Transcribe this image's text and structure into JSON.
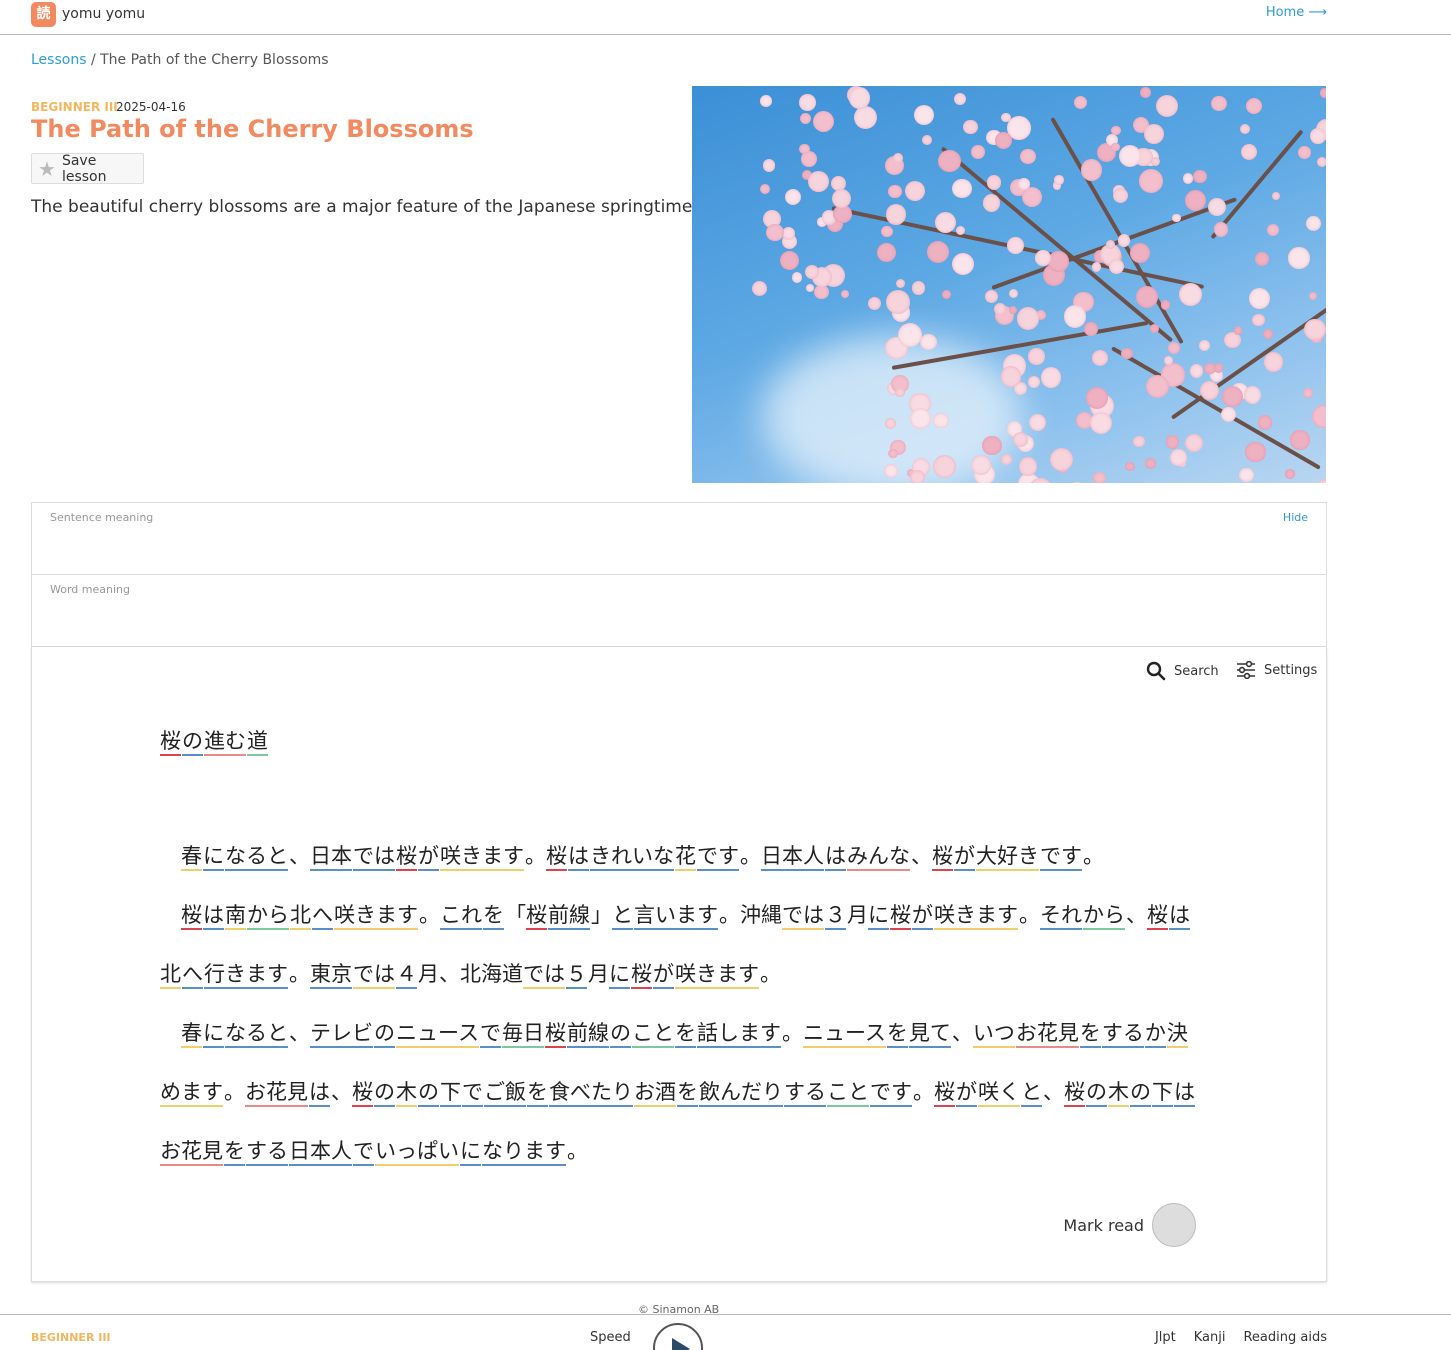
{
  "header": {
    "brand": "yomu yomu",
    "logo_glyph": "読",
    "home_link": "Home ⟶"
  },
  "breadcrumb": {
    "root": "Lessons",
    "separator": " / ",
    "current": "The Path of the Cherry Blossoms"
  },
  "lesson": {
    "level": "BEGINNER III",
    "date": "2025-04-16",
    "title": "The Path of the Cherry Blossoms",
    "save_label": "Save lesson",
    "description": "The beautiful cherry blossoms are a major feature of the Japanese springtime."
  },
  "meaning": {
    "sentence_label": "Sentence meaning",
    "hide_label": "Hide",
    "word_label": "Word meaning"
  },
  "reader": {
    "search_label": "Search",
    "settings_label": "Settings",
    "title_words": [
      {
        "t": "桜",
        "c": "r"
      },
      {
        "t": "の",
        "c": "b"
      },
      {
        "t": "進む",
        "c": "p"
      },
      {
        "t": "道",
        "c": "g"
      }
    ],
    "paragraphs": [
      [
        {
          "t": "春",
          "c": "y"
        },
        {
          "t": "に",
          "c": "b"
        },
        {
          "t": "なると",
          "c": "b"
        },
        {
          "t": "、",
          "c": ""
        },
        {
          "t": "日本",
          "c": "b"
        },
        {
          "t": "では",
          "c": "b"
        },
        {
          "t": "桜",
          "c": "r"
        },
        {
          "t": "が",
          "c": "b"
        },
        {
          "t": "咲きます",
          "c": "y"
        },
        {
          "t": "。",
          "c": ""
        },
        {
          "t": "桜",
          "c": "r"
        },
        {
          "t": "は",
          "c": "b"
        },
        {
          "t": "きれいな",
          "c": "b"
        },
        {
          "t": "花",
          "c": "y"
        },
        {
          "t": "です",
          "c": "b"
        },
        {
          "t": "。",
          "c": ""
        },
        {
          "t": "日本人",
          "c": "b"
        },
        {
          "t": "は",
          "c": "b"
        },
        {
          "t": "みんな",
          "c": "p"
        },
        {
          "t": "、",
          "c": ""
        },
        {
          "t": "桜",
          "c": "r"
        },
        {
          "t": "が",
          "c": "b"
        },
        {
          "t": "大好き",
          "c": "y"
        },
        {
          "t": "です",
          "c": "b"
        },
        {
          "t": "。",
          "c": ""
        }
      ],
      [
        {
          "t": "桜",
          "c": "r"
        },
        {
          "t": "は",
          "c": "b"
        },
        {
          "t": "南",
          "c": "y"
        },
        {
          "t": "から",
          "c": "g"
        },
        {
          "t": "北",
          "c": "y"
        },
        {
          "t": "へ",
          "c": "b"
        },
        {
          "t": "咲きます",
          "c": "y"
        },
        {
          "t": "。",
          "c": ""
        },
        {
          "t": "これ",
          "c": "b"
        },
        {
          "t": "を",
          "c": "b"
        },
        {
          "t": "「",
          "c": ""
        },
        {
          "t": "桜",
          "c": "r"
        },
        {
          "t": "前線",
          "c": "b"
        },
        {
          "t": "」",
          "c": ""
        },
        {
          "t": "と",
          "c": "b"
        },
        {
          "t": "言います",
          "c": "b"
        },
        {
          "t": "。",
          "c": ""
        },
        {
          "t": "沖縄",
          "c": ""
        },
        {
          "t": "では",
          "c": "y"
        },
        {
          "t": "３",
          "c": "b"
        },
        {
          "t": "月",
          "c": ""
        },
        {
          "t": "に",
          "c": "b"
        },
        {
          "t": "桜",
          "c": "r"
        },
        {
          "t": "が",
          "c": "b"
        },
        {
          "t": "咲きます",
          "c": "y"
        },
        {
          "t": "。",
          "c": ""
        },
        {
          "t": "それ",
          "c": "b"
        },
        {
          "t": "から",
          "c": "g"
        },
        {
          "t": "、",
          "c": ""
        },
        {
          "t": "桜",
          "c": "r"
        },
        {
          "t": "は",
          "c": "b"
        },
        {
          "t": "北",
          "c": "y"
        },
        {
          "t": "へ",
          "c": "b"
        },
        {
          "t": "行きます",
          "c": "b"
        },
        {
          "t": "。",
          "c": ""
        },
        {
          "t": "東京",
          "c": "b"
        },
        {
          "t": "では",
          "c": "y"
        },
        {
          "t": "４",
          "c": "b"
        },
        {
          "t": "月",
          "c": ""
        },
        {
          "t": "、",
          "c": ""
        },
        {
          "t": "北海道",
          "c": ""
        },
        {
          "t": "では",
          "c": "y"
        },
        {
          "t": "５",
          "c": "b"
        },
        {
          "t": "月",
          "c": ""
        },
        {
          "t": "に",
          "c": "b"
        },
        {
          "t": "桜",
          "c": "r"
        },
        {
          "t": "が",
          "c": "b"
        },
        {
          "t": "咲きます",
          "c": "y"
        },
        {
          "t": "。",
          "c": ""
        }
      ],
      [
        {
          "t": "春",
          "c": "y"
        },
        {
          "t": "に",
          "c": "b"
        },
        {
          "t": "なると",
          "c": "b"
        },
        {
          "t": "、",
          "c": ""
        },
        {
          "t": "テレビ",
          "c": "b"
        },
        {
          "t": "の",
          "c": "b"
        },
        {
          "t": "ニュース",
          "c": "y"
        },
        {
          "t": "で",
          "c": "b"
        },
        {
          "t": "毎日",
          "c": "g"
        },
        {
          "t": "桜",
          "c": "r"
        },
        {
          "t": "前線",
          "c": "b"
        },
        {
          "t": "の",
          "c": "b"
        },
        {
          "t": "こと",
          "c": "g"
        },
        {
          "t": "を",
          "c": "b"
        },
        {
          "t": "話します",
          "c": "b"
        },
        {
          "t": "。",
          "c": ""
        },
        {
          "t": "ニュース",
          "c": "y"
        },
        {
          "t": "を",
          "c": "b"
        },
        {
          "t": "見て",
          "c": "b"
        },
        {
          "t": "、",
          "c": ""
        },
        {
          "t": "いつ",
          "c": "y"
        },
        {
          "t": "お花見",
          "c": "p"
        },
        {
          "t": "を",
          "c": "b"
        },
        {
          "t": "する",
          "c": "b"
        },
        {
          "t": "か",
          "c": "b"
        },
        {
          "t": "決めます",
          "c": "y"
        },
        {
          "t": "。",
          "c": ""
        },
        {
          "t": "お花見",
          "c": "p"
        },
        {
          "t": "は",
          "c": "b"
        },
        {
          "t": "、",
          "c": ""
        },
        {
          "t": "桜",
          "c": "r"
        },
        {
          "t": "の",
          "c": "b"
        },
        {
          "t": "木",
          "c": "y"
        },
        {
          "t": "の",
          "c": "b"
        },
        {
          "t": "下",
          "c": "b"
        },
        {
          "t": "で",
          "c": "b"
        },
        {
          "t": "ご飯",
          "c": "b"
        },
        {
          "t": "を",
          "c": "b"
        },
        {
          "t": "食べたり",
          "c": "b"
        },
        {
          "t": "お酒",
          "c": "y"
        },
        {
          "t": "を",
          "c": "b"
        },
        {
          "t": "飲んだり",
          "c": "b"
        },
        {
          "t": "する",
          "c": "b"
        },
        {
          "t": "こと",
          "c": "g"
        },
        {
          "t": "です",
          "c": "b"
        },
        {
          "t": "。",
          "c": ""
        },
        {
          "t": "桜",
          "c": "r"
        },
        {
          "t": "が",
          "c": "b"
        },
        {
          "t": "咲く",
          "c": "y"
        },
        {
          "t": "と",
          "c": "b"
        },
        {
          "t": "、",
          "c": ""
        },
        {
          "t": "桜",
          "c": "r"
        },
        {
          "t": "の",
          "c": "b"
        },
        {
          "t": "木",
          "c": "y"
        },
        {
          "t": "の",
          "c": "b"
        },
        {
          "t": "下",
          "c": "b"
        },
        {
          "t": "は",
          "c": "b"
        },
        {
          "t": "お花見",
          "c": "p"
        },
        {
          "t": "を",
          "c": "b"
        },
        {
          "t": "する",
          "c": "b"
        },
        {
          "t": "日本人",
          "c": "b"
        },
        {
          "t": "で",
          "c": "b"
        },
        {
          "t": "いっぱい",
          "c": "y"
        },
        {
          "t": "に",
          "c": "b"
        },
        {
          "t": "なります",
          "c": "b"
        },
        {
          "t": "。",
          "c": ""
        }
      ]
    ],
    "mark_read_label": "Mark read"
  },
  "footer": {
    "copyright": "© Sinamon AB"
  },
  "bottombar": {
    "level": "BEGINNER III",
    "speed_label": "Speed",
    "nav": [
      "Jlpt",
      "Kanji",
      "Reading aids"
    ]
  },
  "colors": {
    "accent": "#f2895f",
    "link": "#2d9bd6",
    "level": "#f2b75e"
  }
}
